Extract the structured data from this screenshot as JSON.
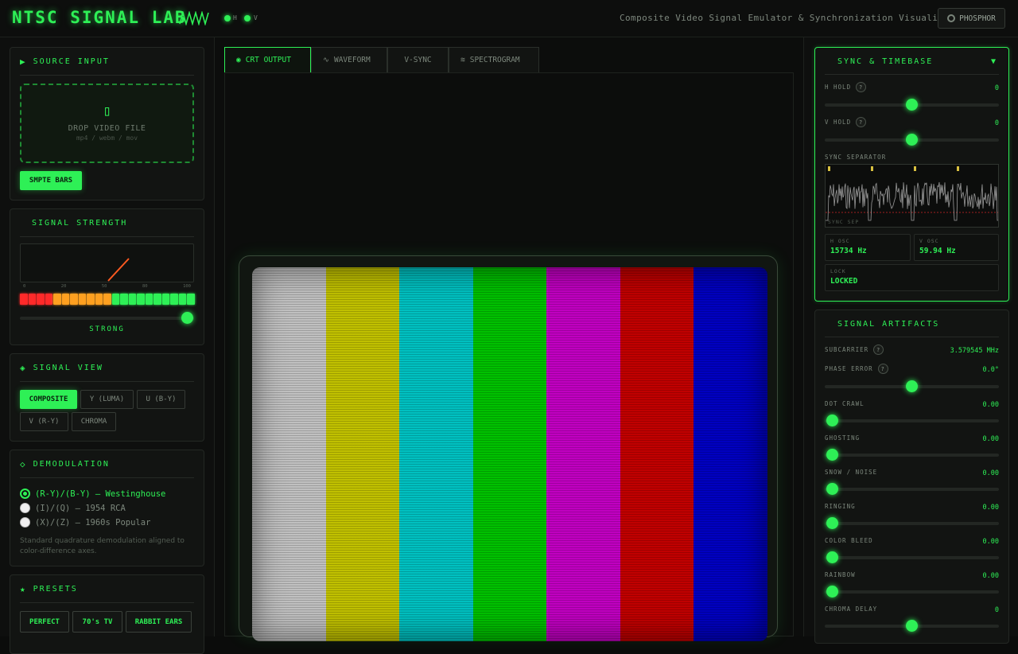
{
  "header": {
    "title": "NTSC SIGNAL LAB",
    "led_h": "H",
    "led_v": "V",
    "subtitle": "Composite Video Signal Emulator & Synchronization Visualizer",
    "phosphor_label": "PHOSPHOR"
  },
  "colors": {
    "accent": "#2ef056",
    "bg": "#0b0c0b",
    "panel": "#121412"
  },
  "source": {
    "title": "SOURCE INPUT",
    "drop_label": "DROP VIDEO FILE",
    "drop_formats": "mp4 / webm / mov",
    "smpte_label": "SMPTE BARS"
  },
  "strength": {
    "title": "SIGNAL STRENGTH",
    "scale": [
      "0",
      "20",
      "50",
      "80",
      "100"
    ],
    "status": "STRONG",
    "level": 1.0
  },
  "signal_view": {
    "title": "SIGNAL VIEW",
    "options": [
      "COMPOSITE",
      "Y (LUMA)",
      "U (B-Y)",
      "V (R-Y)",
      "CHROMA"
    ],
    "selected": "COMPOSITE"
  },
  "demod": {
    "title": "DEMODULATION",
    "options": [
      "(R-Y)/(B-Y) — Westinghouse",
      "(I)/(Q) — 1954 RCA",
      "(X)/(Z) — 1960s Popular"
    ],
    "selected": 0,
    "note": "Standard quadrature demodulation aligned to color-difference axes."
  },
  "presets": {
    "title": "PRESETS",
    "items": [
      "PERFECT",
      "70's TV",
      "RABBIT EARS"
    ]
  },
  "tabs": [
    {
      "label": "CRT OUTPUT",
      "icon": "radio-icon"
    },
    {
      "label": "WAVEFORM",
      "icon": "sine-icon"
    },
    {
      "label": "V-SYNC",
      "icon": ""
    },
    {
      "label": "SPECTROGRAM",
      "icon": "approx-icon"
    }
  ],
  "crt": {
    "bars": [
      "#c0c0c0",
      "#c0c000",
      "#00c0c0",
      "#00c000",
      "#c000c0",
      "#c00000",
      "#0000c0"
    ]
  },
  "sync": {
    "title": "SYNC & TIMEBASE",
    "h_hold": {
      "label": "H HOLD",
      "value": "0",
      "level": 0.5
    },
    "v_hold": {
      "label": "V HOLD",
      "value": "0",
      "level": 0.5
    },
    "separator_label": "SYNC SEPARATOR",
    "osc_caption": "SYNC SEP",
    "h_osc": {
      "label": "H OSC",
      "value": "15734 Hz"
    },
    "v_osc": {
      "label": "V OSC",
      "value": "59.94 Hz"
    },
    "lock": {
      "label": "LOCK",
      "value": "LOCKED"
    }
  },
  "artifacts": {
    "title": "SIGNAL ARTIFACTS",
    "subcarrier": {
      "label": "SUBCARRIER",
      "value": "3.579545 MHz"
    },
    "phase_error": {
      "label": "PHASE ERROR",
      "value": "0.0°",
      "level": 0.5
    },
    "sliders": [
      {
        "label": "DOT CRAWL",
        "value": "0.00",
        "level": 0.0
      },
      {
        "label": "GHOSTING",
        "value": "0.00",
        "level": 0.0
      },
      {
        "label": "SNOW / NOISE",
        "value": "0.00",
        "level": 0.0
      },
      {
        "label": "RINGING",
        "value": "0.00",
        "level": 0.0
      },
      {
        "label": "COLOR BLEED",
        "value": "0.00",
        "level": 0.0
      },
      {
        "label": "RAINBOW",
        "value": "0.00",
        "level": 0.0
      },
      {
        "label": "CHROMA DELAY",
        "value": "0",
        "level": 0.5
      }
    ]
  }
}
